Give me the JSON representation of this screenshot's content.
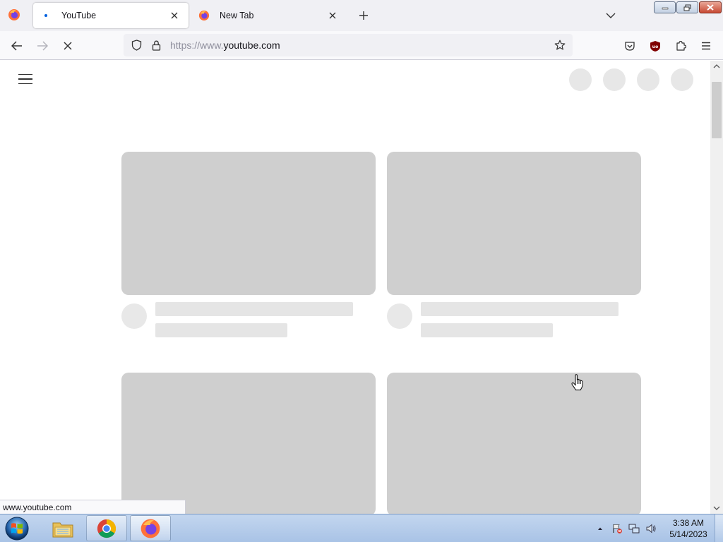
{
  "browser": {
    "tabs": [
      {
        "title": "YouTube",
        "state": "loading",
        "active": true
      },
      {
        "title": "New Tab",
        "active": false
      }
    ],
    "url": {
      "prefix": "https://www.",
      "domain": "youtube.com"
    },
    "status_tip": "www.youtube.com",
    "colors": {
      "tabstrip": "#f0f0f4",
      "navbar": "#f9f9fb",
      "accent": "#0060df"
    }
  },
  "page": {
    "site": "YouTube",
    "state": "loading-skeleton",
    "colors": {
      "thumbnail_placeholder": "#cfcfcf",
      "text_placeholder": "#e5e5e5"
    }
  },
  "taskbar": {
    "apps": [
      "Windows Explorer",
      "Google Chrome",
      "Mozilla Firefox"
    ],
    "clock": {
      "time": "3:38 AM",
      "date": "5/14/2023"
    }
  }
}
